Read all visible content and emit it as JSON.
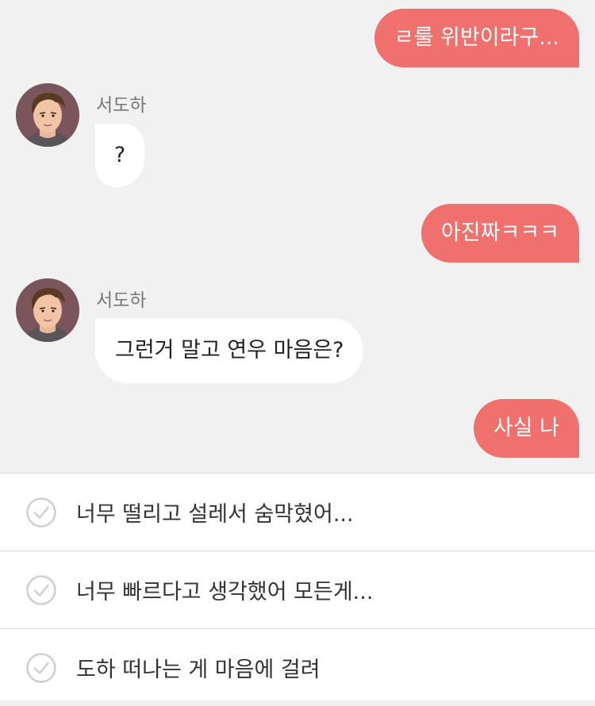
{
  "chat": {
    "messages": [
      {
        "type": "out",
        "text": "ㄹ룰 위반이라구..."
      },
      {
        "type": "in",
        "sender": "서도하",
        "text": "?"
      },
      {
        "type": "out",
        "text": "아진짜ㅋㅋㅋ"
      },
      {
        "type": "in",
        "sender": "서도하",
        "text": "그런거 말고 연우 마음은?"
      },
      {
        "type": "out",
        "text": "사실 나"
      }
    ]
  },
  "choices": [
    {
      "label": "너무 떨리고 설레서 숨막혔어..."
    },
    {
      "label": "너무 빠르다고 생각했어 모든게..."
    },
    {
      "label": "도하 떠나는 게 마음에 걸려"
    }
  ],
  "colors": {
    "accent": "#ef706c",
    "background": "#f1f1f1",
    "check": "#cfcfcf"
  }
}
